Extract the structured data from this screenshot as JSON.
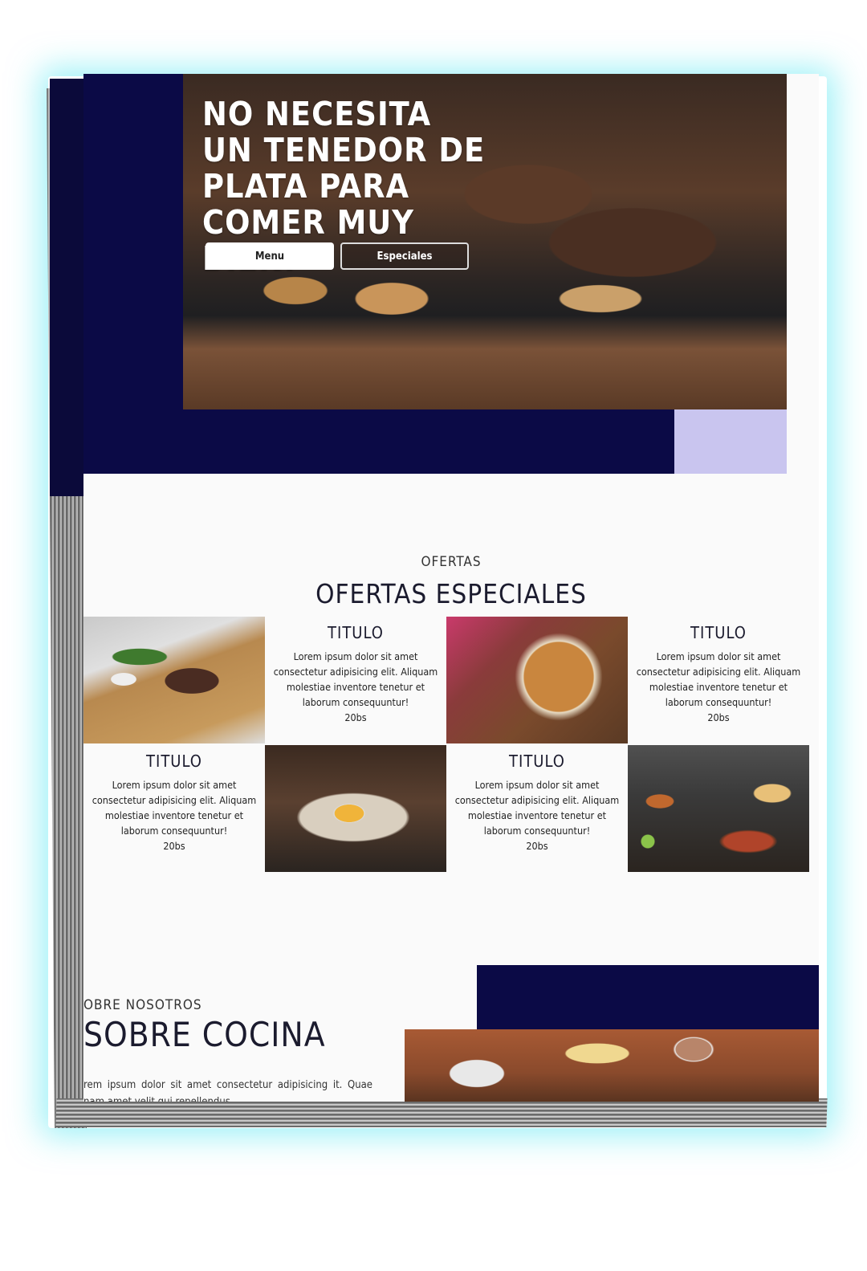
{
  "hero": {
    "title": "NO NECESITA UN TENEDOR DE PLATA PARA COMER MUY BIEN.",
    "buttons": {
      "menu": "Menu",
      "especiales": "Especiales"
    }
  },
  "ofertas": {
    "kicker": "OFERTAS",
    "title": "OFERTAS ESPECIALES",
    "items": [
      {
        "title": "TITULO",
        "description": "Lorem ipsum dolor sit amet consectetur adipisicing elit. Aliquam molestiae inventore tenetur et laborum consequuntur!",
        "price": "20bs"
      },
      {
        "title": "TITULO",
        "description": "Lorem ipsum dolor sit amet consectetur adipisicing elit. Aliquam molestiae inventore tenetur et laborum consequuntur!",
        "price": "20bs"
      },
      {
        "title": "TITULO",
        "description": "Lorem ipsum dolor sit amet consectetur adipisicing elit. Aliquam molestiae inventore tenetur et laborum consequuntur!",
        "price": "20bs"
      },
      {
        "title": "TITULO",
        "description": "Lorem ipsum dolor sit amet consectetur adipisicing elit. Aliquam molestiae inventore tenetur et laborum consequuntur!",
        "price": "20bs"
      }
    ]
  },
  "sobre": {
    "kicker": "OBRE NOSOTROS",
    "title": "SOBRE COCINA",
    "text": "rem ipsum dolor sit amet consectetur adipisicing it. Quae nam amet velit qui repellendus"
  }
}
